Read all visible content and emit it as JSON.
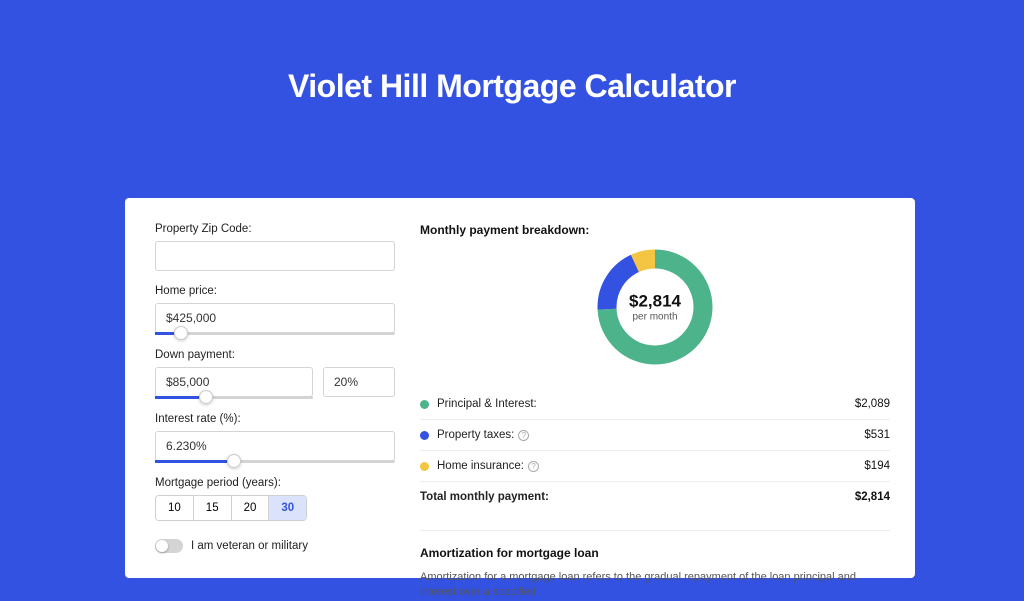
{
  "page": {
    "title": "Violet Hill Mortgage Calculator"
  },
  "form": {
    "zip": {
      "label": "Property Zip Code:",
      "value": ""
    },
    "price": {
      "label": "Home price:",
      "value": "$425,000",
      "slider_pct": 8
    },
    "down": {
      "label": "Down payment:",
      "amount": "$85,000",
      "pct": "20%",
      "slider_pct": 20
    },
    "rate": {
      "label": "Interest rate (%):",
      "value": "6.230%",
      "slider_pct": 30
    },
    "period": {
      "label": "Mortgage period (years):",
      "options": [
        "10",
        "15",
        "20",
        "30"
      ],
      "active": "30"
    },
    "veteran": {
      "label": "I am veteran or military"
    }
  },
  "breakdown": {
    "title": "Monthly payment breakdown:",
    "center_amount": "$2,814",
    "center_sub": "per month",
    "rows": [
      {
        "color": "#4db38a",
        "label": "Principal & Interest:",
        "value": "$2,089",
        "help": false
      },
      {
        "color": "#3452e1",
        "label": "Property taxes:",
        "value": "$531",
        "help": true
      },
      {
        "color": "#f4c542",
        "label": "Home insurance:",
        "value": "$194",
        "help": true
      }
    ],
    "total": {
      "label": "Total monthly payment:",
      "value": "$2,814"
    }
  },
  "amort": {
    "title": "Amortization for mortgage loan",
    "text": "Amortization for a mortgage loan refers to the gradual repayment of the loan principal and interest over a specified"
  },
  "chart_data": {
    "type": "pie",
    "title": "Monthly payment breakdown",
    "series": [
      {
        "name": "Principal & Interest",
        "value": 2089,
        "color": "#4db38a"
      },
      {
        "name": "Property taxes",
        "value": 531,
        "color": "#3452e1"
      },
      {
        "name": "Home insurance",
        "value": 194,
        "color": "#f4c542"
      }
    ],
    "total": 2814,
    "center_label": "$2,814 per month"
  }
}
